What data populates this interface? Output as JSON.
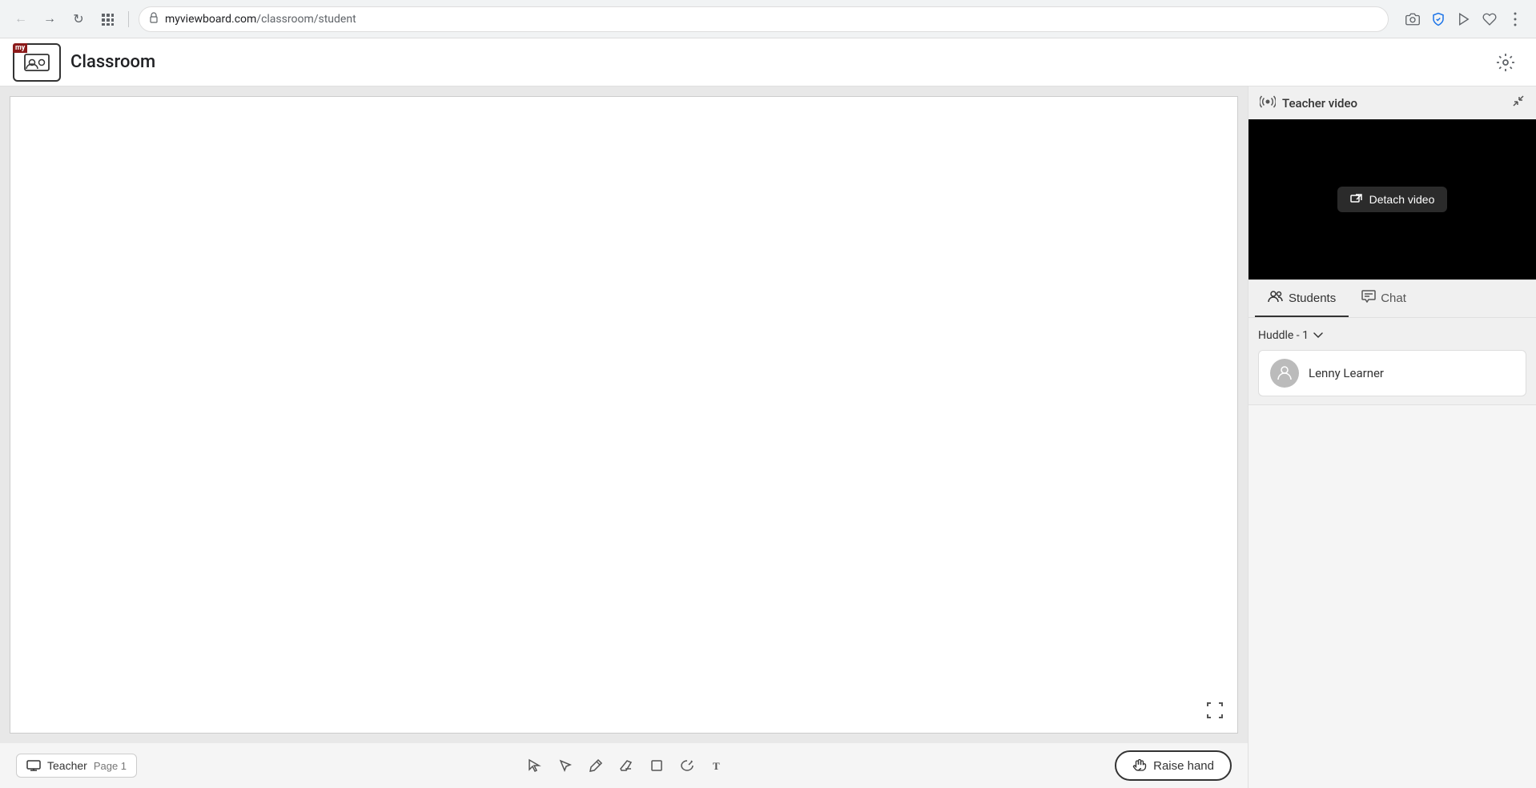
{
  "browser": {
    "url_domain": "myviewboard.com",
    "url_path": "/classroom/student",
    "back_btn": "←",
    "forward_btn": "→",
    "reload_btn": "↻",
    "apps_btn": "⊞"
  },
  "app": {
    "title": "Classroom",
    "logo_text": "my"
  },
  "teacher_video": {
    "section_title": "Teacher video",
    "detach_btn": "Detach video"
  },
  "tabs": {
    "students_label": "Students",
    "chat_label": "Chat"
  },
  "students": {
    "huddle_label": "Huddle - 1",
    "list": [
      {
        "name": "Lenny Learner"
      }
    ]
  },
  "toolbar": {
    "teacher_btn": "Teacher",
    "page_label": "Page 1",
    "raise_hand_btn": "Raise hand"
  },
  "icons": {
    "settings": "⚙",
    "fullscreen": "⛶",
    "lock": "🔒",
    "camera": "📷",
    "shield_check": "✔",
    "play": "▷",
    "heart": "♡",
    "menu": "☰",
    "teacher_monitor": "🖥",
    "video_broadcast": "((•))",
    "detach": "⊟",
    "students_icon": "👥",
    "chat_icon": "💬",
    "minimize_arrow": "↗",
    "down_arrow": "▾",
    "select_tool": "↖",
    "pen_tool": "✏",
    "eraser_tool": "◻",
    "shape_tool": "□",
    "lasso_tool": "⬡",
    "text_tool": "T",
    "raise_hand_icon": "✋",
    "teacher_icon": "🖥"
  }
}
